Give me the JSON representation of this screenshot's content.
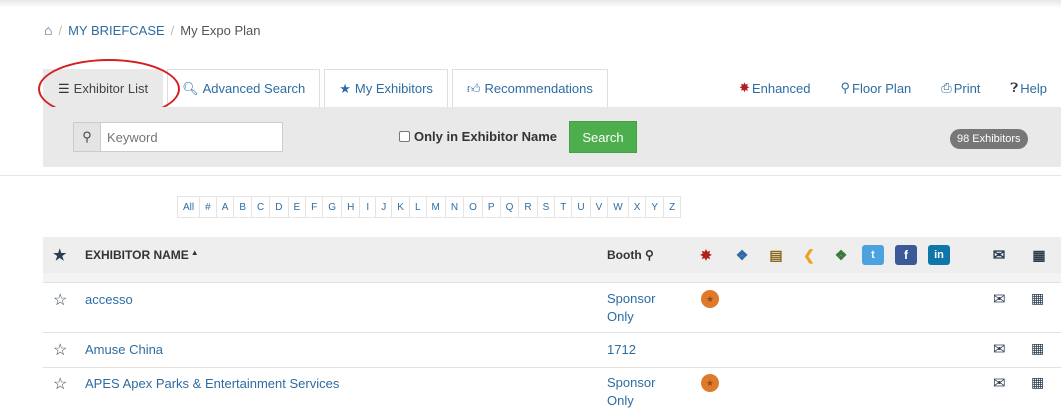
{
  "breadcrumb": {
    "home_icon": "home-icon",
    "separator": "/",
    "item1": "MY BRIEFCASE",
    "item2": "My Expo Plan"
  },
  "tabs": [
    {
      "label": "Exhibitor List",
      "icon": "list-icon",
      "active": true
    },
    {
      "label": "Advanced Search",
      "icon": "search-icon",
      "active": false
    },
    {
      "label": "My Exhibitors",
      "icon": "star-icon",
      "active": false
    },
    {
      "label": "Recommendations",
      "icon": "thumbs-up-icon",
      "active": false
    }
  ],
  "toplinks": {
    "enhanced": "Enhanced",
    "floor_plan": "Floor Plan",
    "print": "Print",
    "help": "Help"
  },
  "search": {
    "placeholder": "Keyword",
    "only_name_label": "Only in Exhibitor Name",
    "button_label": "Search",
    "count": "98",
    "count_label": "Exhibitors"
  },
  "alphabet": [
    "All",
    "#",
    "A",
    "B",
    "C",
    "D",
    "E",
    "F",
    "G",
    "H",
    "I",
    "J",
    "K",
    "L",
    "M",
    "N",
    "O",
    "P",
    "Q",
    "R",
    "S",
    "T",
    "U",
    "V",
    "W",
    "X",
    "Y",
    "Z"
  ],
  "table": {
    "name_header": "EXHIBITOR NAME",
    "sort_indicator": "▲",
    "booth_header": "Booth",
    "header_icons": [
      "enhanced-badge-icon",
      "tag-icon",
      "shopping-bag-icon",
      "rss-icon",
      "price-tag-icon",
      "twitter-icon",
      "facebook-icon",
      "linkedin-icon",
      "mail-icon",
      "calendar-icon"
    ],
    "rows": [
      {
        "name": "accesso",
        "booth_line1": "Sponsor",
        "booth_line2": "Only",
        "enhanced": true
      },
      {
        "name": "Amuse China",
        "booth_line1": "1712",
        "booth_line2": "",
        "enhanced": false
      },
      {
        "name": "APES Apex Parks & Entertainment Services",
        "booth_line1": "Sponsor",
        "booth_line2": "Only",
        "enhanced": true
      }
    ]
  },
  "colors": {
    "link": "#2d6ca2",
    "annotation_circle": "#d42020",
    "search_button": "#4cae4c",
    "enhanced_badge": "#e07a2b"
  }
}
